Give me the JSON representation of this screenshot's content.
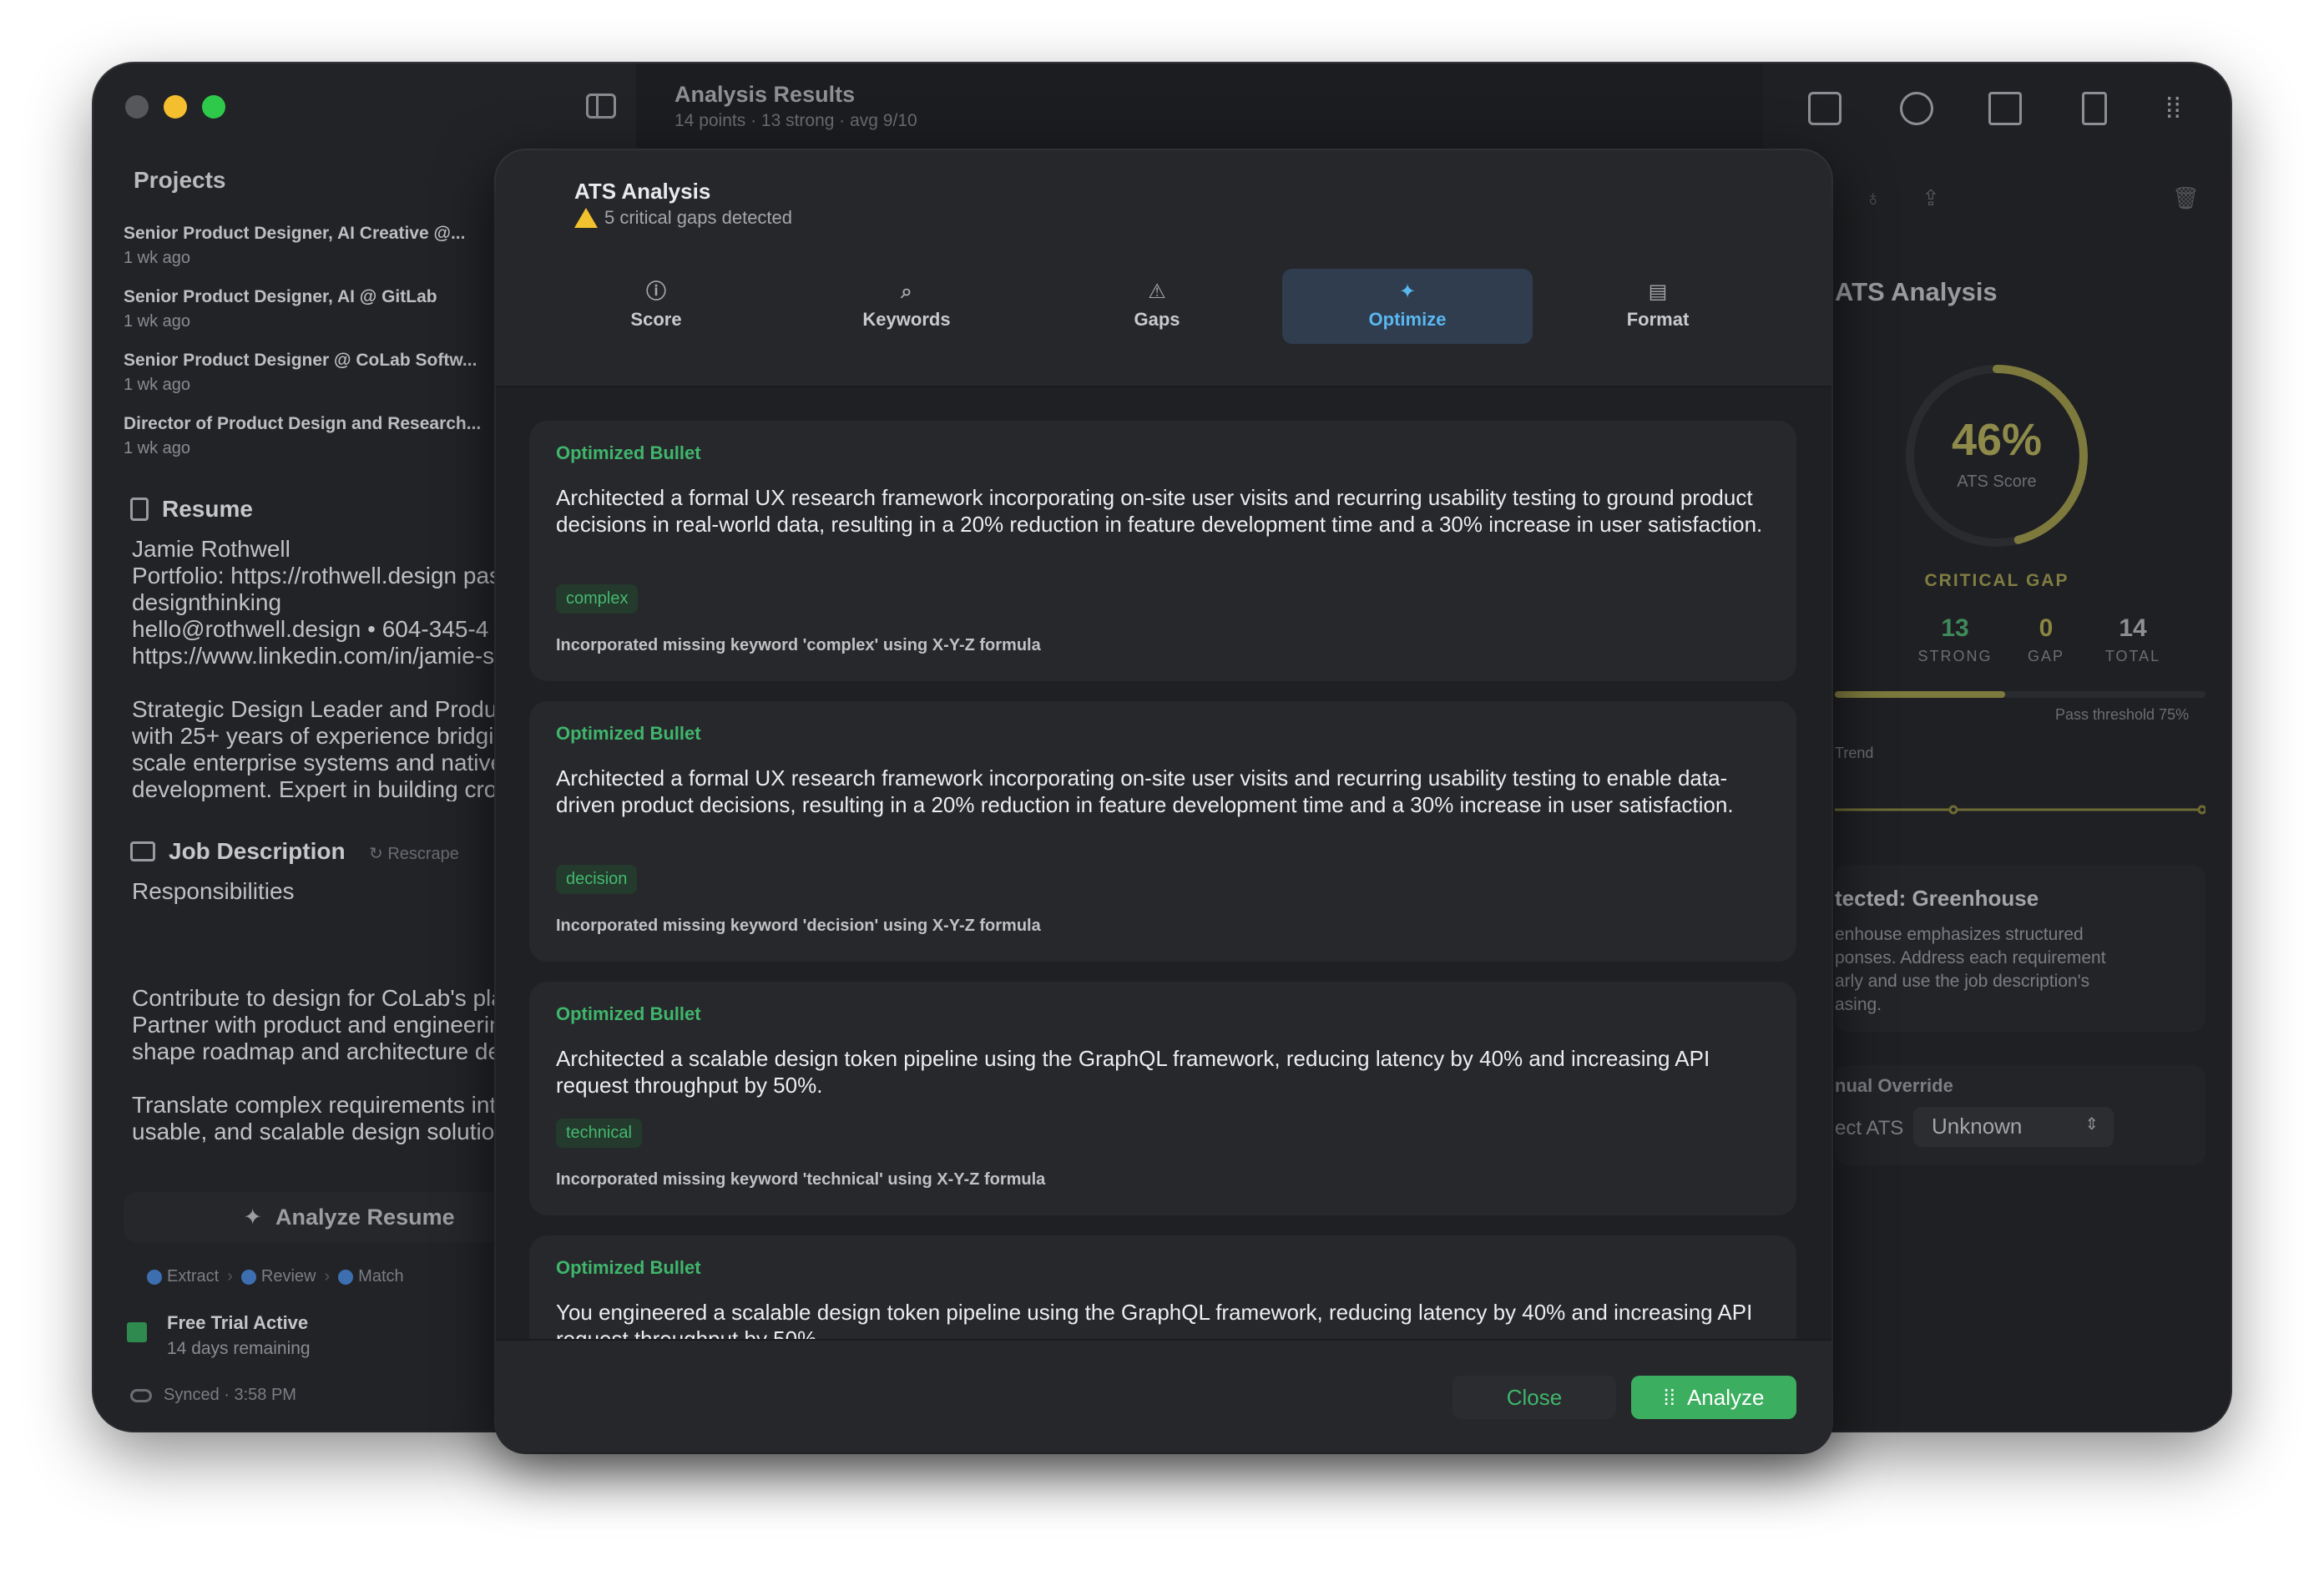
{
  "window": {
    "title": "Analysis Results",
    "subtitle": "14 points · 13 strong · avg 9/10"
  },
  "sidebar": {
    "projects_title": "Projects",
    "projects": [
      {
        "title": "Senior Product Designer, AI Creative @...",
        "date": "1 wk ago"
      },
      {
        "title": "Senior Product Designer, AI @ GitLab",
        "date": "1 wk ago"
      },
      {
        "title": "Senior Product Designer @ CoLab Softw...",
        "date": "1 wk ago"
      },
      {
        "title": "Director of Product Design and Research...",
        "date": "1 wk ago"
      }
    ],
    "resume_title": "Resume",
    "resume_text": "Jamie Rothwell\nPortfolio: https://rothwell.design pas\ndesignthinking\nhello@rothwell.design • 604-345-4\nhttps://www.linkedin.com/in/jamie-s\n\nStrategic Design Leader and Produc\nwith 25+ years of experience bridgi\nscale enterprise systems and native\ndevelopment. Expert in building cros\necosystems (Swift/React) and drivi",
    "job_title": "Job Description",
    "rescrape_label": "Rescrape",
    "job_text": "Responsibilities\n\n\n\nContribute to design for CoLab's pla\nPartner with product and engineerin\nshape roadmap and architecture de\n\nTranslate complex requirements into\nusable, and scalable design solution",
    "analyze_label": "Analyze Resume",
    "steps": [
      "Extract",
      "Review",
      "Match"
    ],
    "trial_title": "Free Trial Active",
    "trial_sub": "14 days remaining",
    "synced": "Synced · 3:58 PM"
  },
  "right_panel": {
    "title": "ATS Analysis",
    "score": "46%",
    "score_label": "ATS Score",
    "score_fraction": 0.46,
    "status": "CRITICAL GAP",
    "stats": [
      {
        "value": "13",
        "label": "STRONG",
        "color": "#3f8a5a"
      },
      {
        "value": "0",
        "label": "GAP",
        "color": "#8a8642"
      },
      {
        "value": "14",
        "label": "TOTAL",
        "color": "#8e8f93"
      }
    ],
    "progress": 0.46,
    "pass_threshold": "Pass threshold 75%",
    "trend_label": "Trend",
    "detected_title": "tected: Greenhouse",
    "detected_text": "enhouse emphasizes structured\nponses. Address each requirement\narly and use the job description's\nasing.",
    "override_title": "nual Override",
    "override_label": "ect ATS",
    "override_value": "Unknown"
  },
  "modal": {
    "title": "ATS Analysis",
    "subtitle": "5 critical gaps detected",
    "tabs": [
      {
        "label": "Score",
        "icon": "info-icon",
        "glyph": "ⓘ"
      },
      {
        "label": "Keywords",
        "icon": "search-icon",
        "glyph": "⌕"
      },
      {
        "label": "Gaps",
        "icon": "warning-icon",
        "glyph": "⚠"
      },
      {
        "label": "Optimize",
        "icon": "sparkle-icon",
        "glyph": "✦"
      },
      {
        "label": "Format",
        "icon": "document-icon",
        "glyph": "▤"
      }
    ],
    "active_tab": "Optimize",
    "cards": [
      {
        "heading": "Optimized Bullet",
        "text": "Architected a formal UX research framework incorporating on-site user visits and recurring usability testing to ground product decisions in real-world data, resulting in a 20% reduction in feature development time and a 30% increase in user satisfaction.",
        "keyword": "complex",
        "note": "Incorporated missing keyword 'complex' using X-Y-Z formula"
      },
      {
        "heading": "Optimized Bullet",
        "text": "Architected a formal UX research framework incorporating on-site user visits and recurring usability testing to enable data-driven product decisions, resulting in a 20% reduction in feature development time and a 30% increase in user satisfaction.",
        "keyword": "decision",
        "note": "Incorporated missing keyword 'decision' using X-Y-Z formula"
      },
      {
        "heading": "Optimized Bullet",
        "text": "Architected a scalable design token pipeline using the GraphQL framework, reducing latency by 40% and increasing API request throughput by 50%.",
        "keyword": "technical",
        "note": "Incorporated missing keyword 'technical' using X-Y-Z formula"
      },
      {
        "heading": "Optimized Bullet",
        "text": "You engineered a scalable design token pipeline using the GraphQL framework, reducing latency by 40% and increasing API request throughput by 50%."
      }
    ],
    "close_label": "Close",
    "analyze_label": "Analyze"
  },
  "colors": {
    "accent_green": "#3cae60",
    "tab_active": "#5ab7f0",
    "warning": "#f2c12e",
    "gauge": "#7e7a3d"
  }
}
